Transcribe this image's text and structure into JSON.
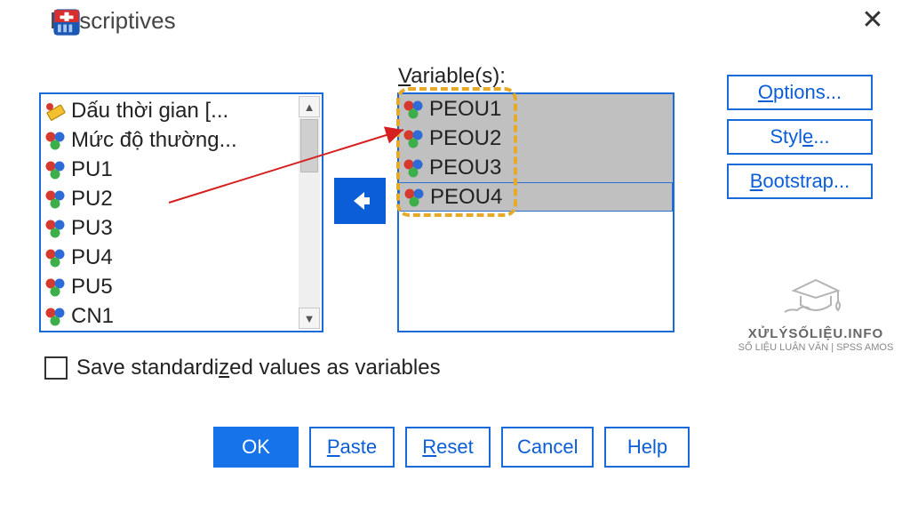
{
  "window": {
    "title": "Descriptives"
  },
  "source_list": {
    "items": [
      {
        "label": "Dấu thời gian [...",
        "icon": "ruler"
      },
      {
        "label": "Mức độ thường...",
        "icon": "nominal"
      },
      {
        "label": "PU1",
        "icon": "nominal"
      },
      {
        "label": "PU2",
        "icon": "nominal"
      },
      {
        "label": "PU3",
        "icon": "nominal"
      },
      {
        "label": "PU4",
        "icon": "nominal"
      },
      {
        "label": "PU5",
        "icon": "nominal"
      },
      {
        "label": "CN1",
        "icon": "nominal"
      }
    ]
  },
  "target": {
    "label_prefix": "V",
    "label_rest": "ariable(s):",
    "items": [
      {
        "label": "PEOU1"
      },
      {
        "label": "PEOU2"
      },
      {
        "label": "PEOU3"
      },
      {
        "label": "PEOU4"
      }
    ]
  },
  "side_buttons": {
    "options": {
      "ul": "O",
      "rest": "ptions..."
    },
    "style": {
      "pre": "Styl",
      "ul": "e",
      "post": "..."
    },
    "bootstrap": {
      "ul": "B",
      "rest": "ootstrap..."
    }
  },
  "checkbox": {
    "pre": "Save standardi",
    "ul": "z",
    "post": "ed values as variables",
    "checked": false
  },
  "buttons": {
    "ok": "OK",
    "paste": {
      "ul": "P",
      "rest": "aste"
    },
    "reset": {
      "ul": "R",
      "rest": "eset"
    },
    "cancel": "Cancel",
    "help": "Help"
  },
  "watermark": {
    "line1": "XỬLÝSỐLIỆU.INFO",
    "line2": "SỐ LIỆU LUẬN VĂN | SPSS AMOS"
  }
}
